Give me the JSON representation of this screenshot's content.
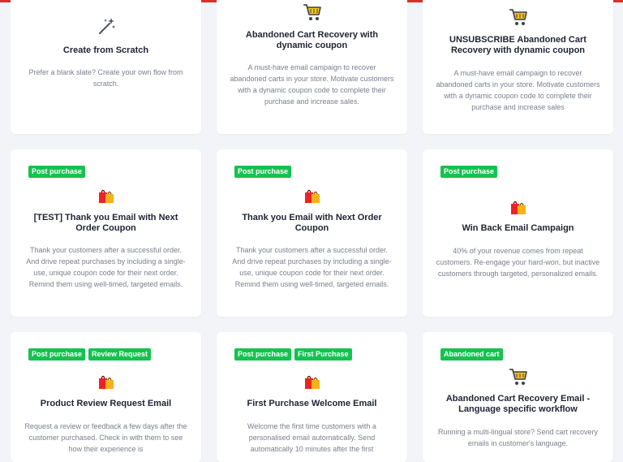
{
  "cards": [
    {
      "icon": "magic-wand-icon",
      "tags": [],
      "title": "Create from Scratch",
      "description": "Prefer a blank slate? Create your own flow from scratch."
    },
    {
      "icon": "shopping-cart-icon",
      "tags": [],
      "title": "Abandoned Cart Recovery with dynamic coupon",
      "description": "A must-have email campaign to recover abandoned carts in your store. Motivate customers with a dynamic coupon code to complete their purchase and increase sales."
    },
    {
      "icon": "shopping-cart-icon",
      "tags": [],
      "title": "UNSUBSCRIBE Abandoned Cart Recovery with dynamic coupon",
      "description": "A must-have email campaign to recover abandoned carts in your store. Motivate customers with a dynamic coupon code to complete their purchase and increase sales"
    },
    {
      "icon": "shopping-bags-icon",
      "tags": [
        "Post purchase"
      ],
      "title": "[TEST] Thank you Email with Next Order Coupon",
      "description": "Thank your customers after a successful order. And drive repeat purchases by including a single-use, unique coupon code for their next order. Remind them using well-timed, targeted emails."
    },
    {
      "icon": "shopping-bags-icon",
      "tags": [
        "Post purchase"
      ],
      "title": "Thank you Email with Next Order Coupon",
      "description": "Thank your customers after a successful order. And drive repeat purchases by including a single-use, unique coupon code for their next order. Remind them using well-timed, targeted emails."
    },
    {
      "icon": "shopping-bags-icon",
      "tags": [
        "Post purchase"
      ],
      "title": "Win Back Email Campaign",
      "description": "40% of your revenue comes from repeat customers. Re-engage your hard-won, but inactive customers through targeted, personalized emails."
    },
    {
      "icon": "shopping-bags-icon",
      "tags": [
        "Post purchase",
        "Review Request"
      ],
      "title": "Product Review Request Email",
      "description": "Request a review or feedback a few days after the customer purchased. Check in with them to see how their experience is"
    },
    {
      "icon": "shopping-bags-icon",
      "tags": [
        "Post purchase",
        "First Purchase"
      ],
      "title": "First Purchase Welcome Email",
      "description": "Welcome the first time customers with a personalised email automatically. Send automatically 10 minutes after the first"
    },
    {
      "icon": "shopping-cart-icon",
      "tags": [
        "Abandoned cart"
      ],
      "title": "Abandoned Cart Recovery Email - Language specific workflow",
      "description": "Running a multi-lingual store? Send cart recovery emails in customer's language."
    }
  ],
  "colors": {
    "tag_green": "#15c24f",
    "title_text": "#1f2433",
    "desc_text": "#7a7f8c",
    "top_bar": "#d9302c"
  }
}
